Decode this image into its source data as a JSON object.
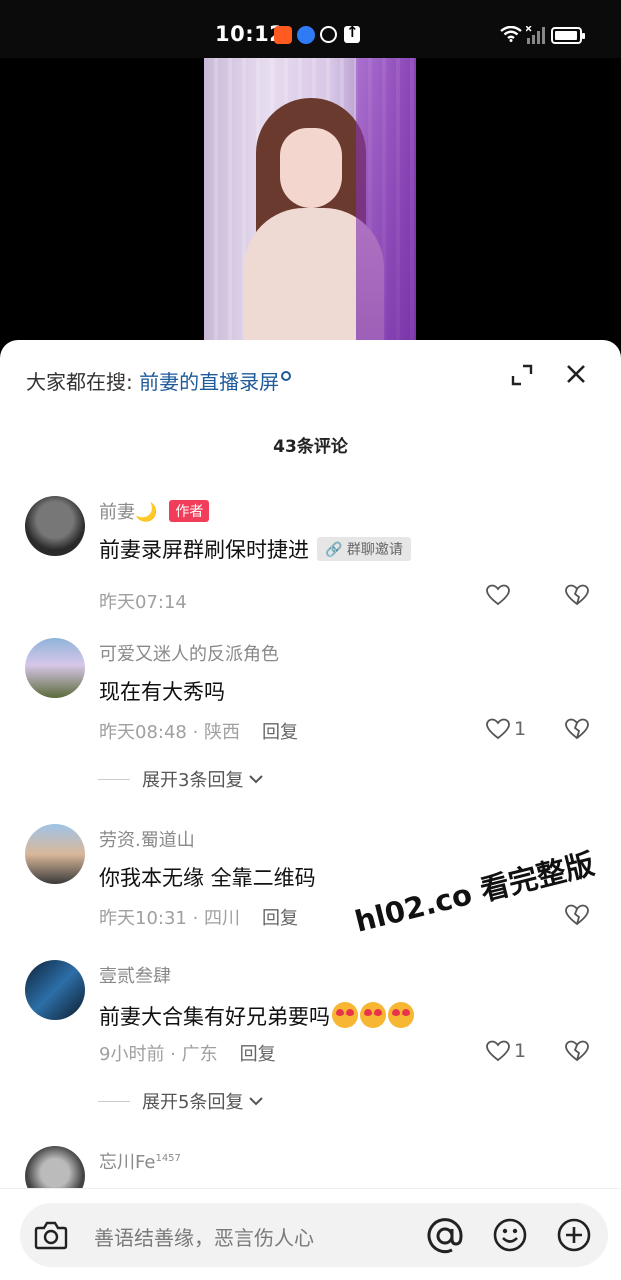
{
  "status_bar": {
    "time": "10:12",
    "icons": [
      "app-orange-icon",
      "app-blue-icon",
      "hotspot-icon",
      "upload-icon",
      "wifi-icon",
      "signal-icon",
      "battery-icon"
    ]
  },
  "search_bar": {
    "prefix": "大家都在搜:",
    "term": "前妻的直播录屏"
  },
  "comments_header": {
    "count_label": "43条评论"
  },
  "comments": [
    {
      "name": "前妻🌙",
      "badge": "作者",
      "text": "前妻录屏群刷保时捷进",
      "chip": "🔗 群聊邀请",
      "time": "昨天07:14"
    },
    {
      "name": "可爱又迷人的反派角色",
      "text": "现在有大秀吗",
      "time": "昨天08:48 · 陕西",
      "reply": "回复",
      "likes": "1",
      "expand": "展开3条回复"
    },
    {
      "name": "劳资.蜀道山",
      "text": "你我本无缘 全靠二维码",
      "time": "昨天10:31 · 四川",
      "reply": "回复"
    },
    {
      "name": "壹贰叁肆",
      "text": "前妻大合集有好兄弟要吗",
      "time": "9小时前 · 广东",
      "reply": "回复",
      "likes": "1",
      "expand": "展开5条回复"
    },
    {
      "name": "忘川Fe",
      "name_sup": "1457"
    }
  ],
  "watermark": "hl02.co 看完整版",
  "input": {
    "placeholder": "善语结善缘，恶言伤人心"
  },
  "colors": {
    "accent_link": "#1f5a9a",
    "author_badge": "#f23d5a"
  }
}
